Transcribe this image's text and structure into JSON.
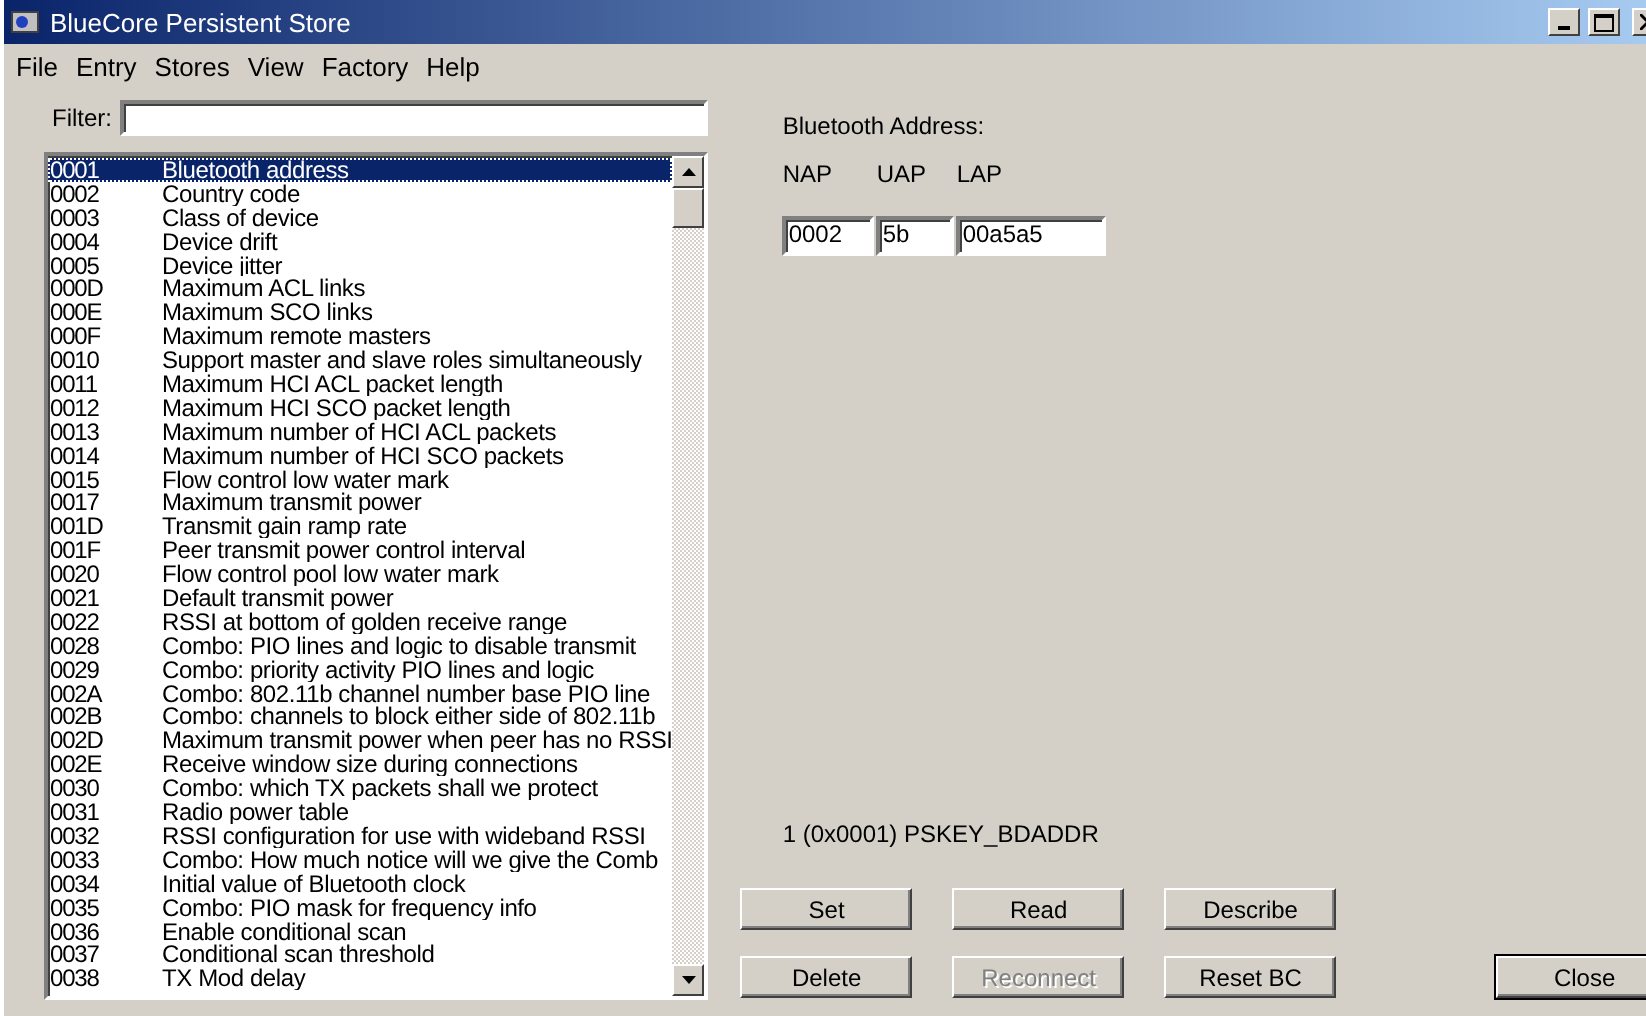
{
  "window": {
    "title": "BlueCore Persistent Store"
  },
  "menu": [
    {
      "label": "File"
    },
    {
      "label": "Entry"
    },
    {
      "label": "Stores"
    },
    {
      "label": "View"
    },
    {
      "label": "Factory"
    },
    {
      "label": "Help"
    }
  ],
  "filter": {
    "label": "Filter:"
  },
  "list": {
    "rows": [
      {
        "code": "0001",
        "description": "Bluetooth address",
        "selected": true
      },
      {
        "code": "0002",
        "description": "Country code",
        "selected": false
      },
      {
        "code": "0003",
        "description": "Class of device",
        "selected": false
      },
      {
        "code": "0004",
        "description": "Device drift",
        "selected": false
      },
      {
        "code": "0005",
        "description": "Device jitter",
        "selected": false
      },
      {
        "code": "000D",
        "description": "Maximum ACL links",
        "selected": false
      },
      {
        "code": "000E",
        "description": "Maximum SCO links",
        "selected": false
      },
      {
        "code": "000F",
        "description": "Maximum remote masters",
        "selected": false
      },
      {
        "code": "0010",
        "description": "Support master and slave roles simultaneously",
        "selected": false
      },
      {
        "code": "0011",
        "description": "Maximum HCI ACL packet length",
        "selected": false
      },
      {
        "code": "0012",
        "description": "Maximum HCI SCO packet length",
        "selected": false
      },
      {
        "code": "0013",
        "description": "Maximum number of HCI ACL packets",
        "selected": false
      },
      {
        "code": "0014",
        "description": "Maximum number of HCI SCO packets",
        "selected": false
      },
      {
        "code": "0015",
        "description": "Flow control low water mark",
        "selected": false
      },
      {
        "code": "0017",
        "description": "Maximum transmit power",
        "selected": false
      },
      {
        "code": "001D",
        "description": "Transmit gain ramp rate",
        "selected": false
      },
      {
        "code": "001F",
        "description": "Peer transmit power control interval",
        "selected": false
      },
      {
        "code": "0020",
        "description": "Flow control pool low water mark",
        "selected": false
      },
      {
        "code": "0021",
        "description": "Default transmit power",
        "selected": false
      },
      {
        "code": "0022",
        "description": "RSSI at bottom of golden receive range",
        "selected": false
      },
      {
        "code": "0028",
        "description": "Combo: PIO lines and logic to disable transmit",
        "selected": false
      },
      {
        "code": "0029",
        "description": "Combo: priority activity PIO lines and logic",
        "selected": false
      },
      {
        "code": "002A",
        "description": "Combo: 802.11b channel number base PIO line",
        "selected": false
      },
      {
        "code": "002B",
        "description": "Combo: channels to block either side of 802.11b",
        "selected": false
      },
      {
        "code": "002D",
        "description": "Maximum transmit power when peer has no RSSI",
        "selected": false
      },
      {
        "code": "002E",
        "description": "Receive window size during connections",
        "selected": false
      },
      {
        "code": "0030",
        "description": "Combo: which TX packets shall we protect",
        "selected": false
      },
      {
        "code": "0031",
        "description": "Radio power table",
        "selected": false
      },
      {
        "code": "0032",
        "description": "RSSI configuration for use with wideband RSSI",
        "selected": false
      },
      {
        "code": "0033",
        "description": "Combo: How much notice will we give the Comb",
        "selected": false
      },
      {
        "code": "0034",
        "description": "Initial value of Bluetooth clock",
        "selected": false
      },
      {
        "code": "0035",
        "description": "Combo: PIO mask for frequency info",
        "selected": false
      },
      {
        "code": "0036",
        "description": "Enable conditional scan",
        "selected": false
      },
      {
        "code": "0037",
        "description": "Conditional scan threshold",
        "selected": false
      },
      {
        "code": "0038",
        "description": "TX Mod delay",
        "selected": false
      }
    ]
  },
  "address": {
    "title": "Bluetooth Address:",
    "fields": [
      {
        "label": "NAP",
        "value": "0002"
      },
      {
        "label": "UAP",
        "value": "5b"
      },
      {
        "label": "LAP",
        "value": "00a5a5"
      }
    ]
  },
  "status": "1 (0x0001) PSKEY_BDADDR",
  "buttons": [
    {
      "label": "Set",
      "disabled": false,
      "default": false
    },
    {
      "label": "Read",
      "disabled": false,
      "default": false
    },
    {
      "label": "Describe",
      "disabled": false,
      "default": false
    },
    {
      "label": "Delete",
      "disabled": false,
      "default": false
    },
    {
      "label": "Reconnect",
      "disabled": true,
      "default": false
    },
    {
      "label": "Reset BC",
      "disabled": false,
      "default": false
    },
    {
      "label": "Close",
      "disabled": false,
      "default": true
    }
  ]
}
